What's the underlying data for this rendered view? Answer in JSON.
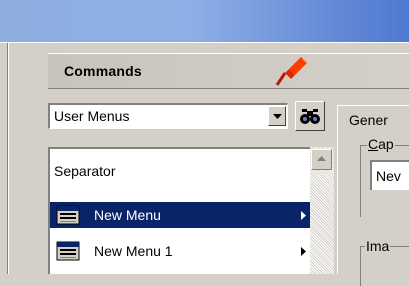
{
  "panel": {
    "title": "Commands"
  },
  "combo": {
    "value": "User Menus"
  },
  "list": {
    "items": [
      {
        "label": "Separator",
        "icon": "none",
        "submenu": false,
        "selected": false
      },
      {
        "label": "New Menu",
        "icon": "menu-icon",
        "submenu": true,
        "selected": true
      },
      {
        "label": "New Menu 1",
        "icon": "menu-icon",
        "submenu": true,
        "selected": false
      }
    ]
  },
  "tabs": {
    "general_label": "Gener"
  },
  "properties": {
    "caption_label_accel": "C",
    "caption_label_rest": "ap",
    "caption_value": "Nev",
    "image_label": "Ima"
  },
  "colors": {
    "selection": "#0a246a",
    "titlebar": "#4f78d0",
    "pin": "#ff3b00"
  }
}
